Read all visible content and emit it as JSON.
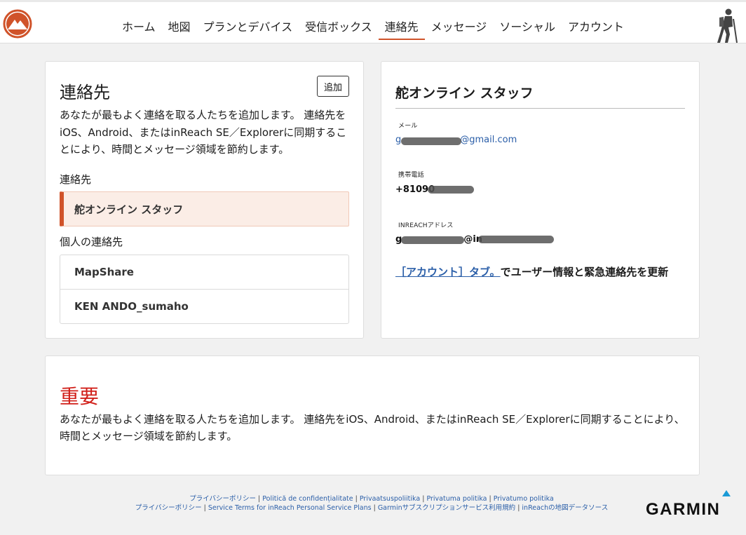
{
  "nav": {
    "items": [
      {
        "label": "ホーム",
        "active": false
      },
      {
        "label": "地図",
        "active": false
      },
      {
        "label": "プランとデバイス",
        "active": false
      },
      {
        "label": "受信ボックス",
        "active": false
      },
      {
        "label": "連絡先",
        "active": true
      },
      {
        "label": "メッセージ",
        "active": false
      },
      {
        "label": "ソーシャル",
        "active": false
      },
      {
        "label": "アカウント",
        "active": false
      }
    ]
  },
  "contacts_panel": {
    "title": "連絡先",
    "add_button": "追加",
    "description": "あなたが最もよく連絡を取る人たちを追加します。 連絡先をiOS、Android、またはinReach SE／Explorerに同期することにより、時間とメッセージ領域を節約します。",
    "contacts_label": "連絡先",
    "selected_contact": "舵オンライン スタッフ",
    "personal_label": "個人の連絡先",
    "personal_contacts": [
      "MapShare",
      "KEN ANDO_sumaho"
    ]
  },
  "detail_panel": {
    "name": "舵オンライン スタッフ",
    "email_label": "メール",
    "email_value_prefix": "g",
    "email_value_suffix": "@gmail.com",
    "phone_label": "携帯電話",
    "phone_value_prefix": "+81090",
    "inreach_label": "INREACHアドレス",
    "inreach_value_prefix": "g",
    "inreach_value_mid": "@in",
    "account_link": "［アカウント］タブ。",
    "account_text": "でユーザー情報と緊急連絡先を更新"
  },
  "important": {
    "title": "重要",
    "text": "あなたが最もよく連絡を取る人たちを追加します。 連絡先をiOS、Android、またはinReach SE／Explorerに同期することにより、時間とメッセージ領域を節約します。"
  },
  "footer": {
    "line1": [
      "プライバシーポリシー",
      "Politică de confidențialitate",
      "Privaatsuspoliitika",
      "Privatuma politika",
      "Privatumo politika"
    ],
    "line2": [
      "プライバシーポリシー",
      "Service Terms for inReach Personal Service Plans",
      "Garminサブスクリプションサービス利用規約",
      "inReachの地図データソース"
    ]
  },
  "brand": {
    "name": "GARMIN"
  },
  "colors": {
    "accent": "#d0532a",
    "link": "#2a5ea8",
    "important": "#d1201a"
  },
  "icons": {
    "logo": "mountain-logo-icon",
    "profile": "hiker-icon",
    "brand": "garmin-triangle-icon"
  }
}
